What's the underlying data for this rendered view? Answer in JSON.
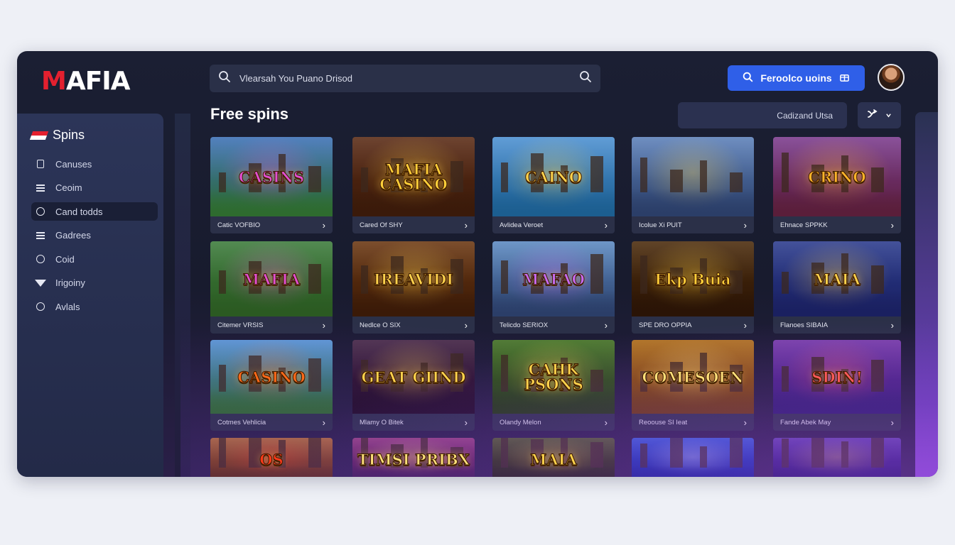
{
  "brand": {
    "logo_first": "M",
    "logo_rest": "AFIA"
  },
  "sidebar": {
    "title": "Spins",
    "items": [
      {
        "label": "Canuses",
        "icon": "square-icon",
        "active": false
      },
      {
        "label": "Ceoim",
        "icon": "menu-icon",
        "active": false
      },
      {
        "label": "Cand todds",
        "icon": "globe-icon",
        "active": true
      },
      {
        "label": "Gadrees",
        "icon": "list-icon",
        "active": false
      },
      {
        "label": "Coid",
        "icon": "drop-icon",
        "active": false
      },
      {
        "label": "Irigoiny",
        "icon": "triangle-icon",
        "active": false
      },
      {
        "label": "Avlals",
        "icon": "circle-slash-icon",
        "active": false
      }
    ]
  },
  "search": {
    "value": "Vlearsah You Puano Drisod"
  },
  "cta": {
    "label": "Feroolco uoins"
  },
  "page": {
    "title": "Free spins"
  },
  "filter": {
    "label": "Cadizand Utsa"
  },
  "games": [
    {
      "title": "CASINS",
      "label": "Catic VOFBIO"
    },
    {
      "title": "MAFIA CASINO",
      "label": "Cared Of SHY"
    },
    {
      "title": "CAINO",
      "label": "Avlidea Veroet"
    },
    {
      "title": "",
      "label": "Icolue Xi PUIT"
    },
    {
      "title": "CRINO",
      "label": "Ehnace SPPKK"
    },
    {
      "title": "MAFIA",
      "label": "Citemer VRSIS"
    },
    {
      "title": "IREAVIDI",
      "label": "Nedlce O SIX"
    },
    {
      "title": "MAFAO",
      "label": "Telicdo SERIOX"
    },
    {
      "title": "Ekp Buia",
      "label": "SPE DRO OPPIA"
    },
    {
      "title": "MAIA",
      "label": "Flanoes SIBAIA"
    },
    {
      "title": "CASINO",
      "label": "Cotmes Vehlicia"
    },
    {
      "title": "GEAT GIIND",
      "label": "Mlamy O Bitek"
    },
    {
      "title": "CAHK PSONS",
      "label": "Olandy Melon"
    },
    {
      "title": "COMESOEN",
      "label": "Reoouse SI Ieat"
    },
    {
      "title": "SDIN!",
      "label": "Fande Abek May"
    },
    {
      "title": "OS",
      "label": ""
    },
    {
      "title": "TIMSI PRIBX",
      "label": ""
    },
    {
      "title": "MAIA",
      "label": ""
    },
    {
      "title": "",
      "label": ""
    },
    {
      "title": "",
      "label": ""
    }
  ],
  "theme": {
    "accent": "#2f5fe8",
    "brand_red": "#e4202f",
    "bg": "#181b2e"
  }
}
